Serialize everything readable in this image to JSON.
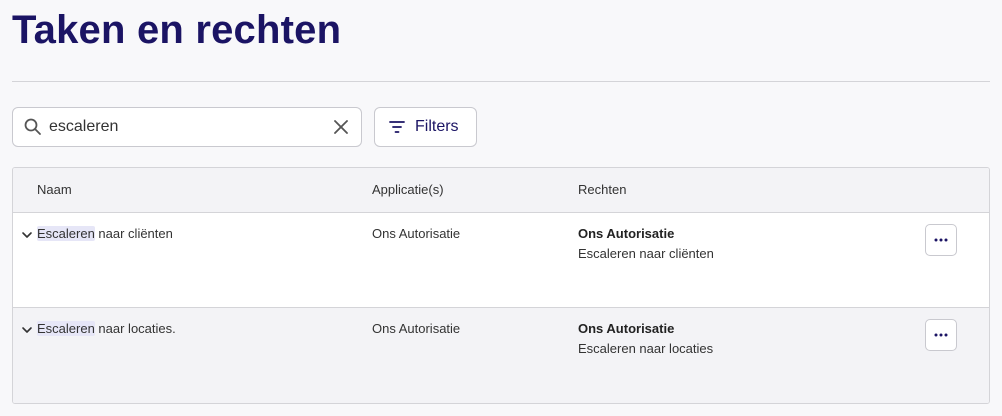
{
  "page": {
    "title": "Taken en rechten"
  },
  "search": {
    "value": "escaleren"
  },
  "toolbar": {
    "filters_label": "Filters"
  },
  "table": {
    "headers": {
      "name": "Naam",
      "applications": "Applicatie(s)",
      "rights": "Rechten"
    },
    "rows": [
      {
        "name_highlight": "Escaleren",
        "name_rest": " naar cliënten",
        "application": "Ons Autorisatie",
        "rights_title": "Ons Autorisatie",
        "rights_detail": "Escaleren naar cliënten"
      },
      {
        "name_highlight": "Escaleren",
        "name_rest": " naar locaties.",
        "application": "Ons Autorisatie",
        "rights_title": "Ons Autorisatie",
        "rights_detail": "Escaleren naar locaties"
      }
    ]
  },
  "colors": {
    "brand": "#1b1464",
    "highlight": "#e6e6f7",
    "row_alt": "#f3f3f6"
  },
  "icons": [
    "search-icon",
    "close-icon",
    "filter-icon",
    "chevron-down-icon",
    "more-icon"
  ]
}
